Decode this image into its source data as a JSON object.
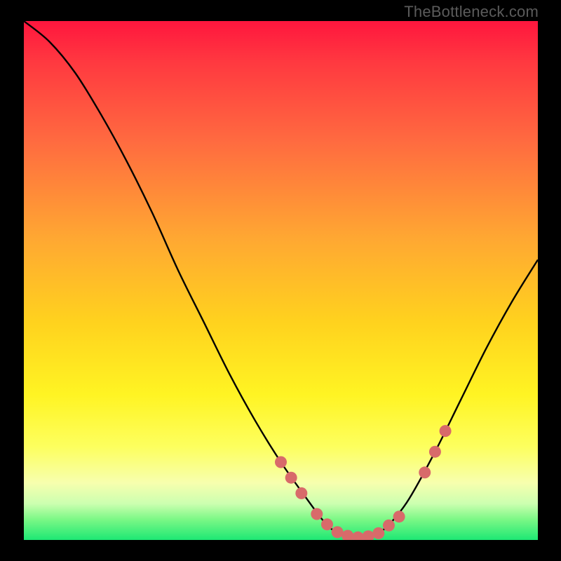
{
  "watermark": "TheBottleneck.com",
  "colors": {
    "curve_stroke": "#000000",
    "marker_fill": "#d86a6a",
    "background": "#000000"
  },
  "chart_data": {
    "type": "line",
    "title": "",
    "xlabel": "",
    "ylabel": "",
    "xlim": [
      0,
      100
    ],
    "ylim": [
      0,
      100
    ],
    "grid": false,
    "legend": false,
    "series": [
      {
        "name": "bottleneck-curve",
        "x": [
          0,
          5,
          10,
          15,
          20,
          25,
          30,
          35,
          40,
          45,
          50,
          55,
          58,
          60,
          62,
          64,
          66,
          68,
          70,
          72,
          75,
          80,
          85,
          90,
          95,
          100
        ],
        "values": [
          100,
          96,
          90,
          82,
          73,
          63,
          52,
          42,
          32,
          23,
          15,
          8,
          4,
          2,
          1,
          0.5,
          0.5,
          1,
          2,
          4,
          8,
          17,
          27,
          37,
          46,
          54
        ]
      }
    ],
    "markers": {
      "name": "threshold-dots",
      "x": [
        50,
        52,
        54,
        57,
        59,
        61,
        63,
        65,
        67,
        69,
        71,
        73,
        78,
        80,
        82
      ],
      "values": [
        15,
        12,
        9,
        5,
        3,
        1.5,
        0.8,
        0.5,
        0.7,
        1.3,
        2.8,
        4.5,
        13,
        17,
        21
      ]
    }
  }
}
